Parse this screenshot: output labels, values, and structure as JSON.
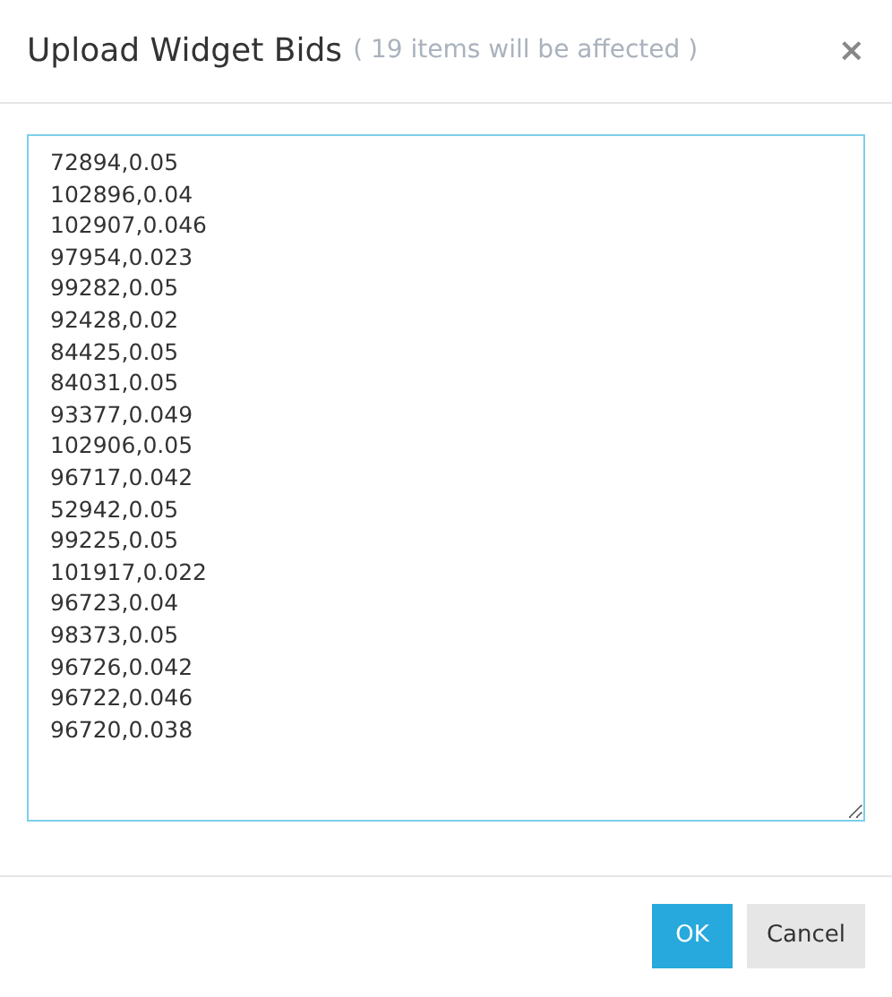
{
  "dialog": {
    "title": "Upload Widget Bids",
    "subtitle": "( 19 items will be affected )",
    "close": "×"
  },
  "input": {
    "value": [
      "72894,0.05",
      "102896,0.04",
      "102907,0.046",
      "97954,0.023",
      "99282,0.05",
      "92428,0.02",
      "84425,0.05",
      "84031,0.05",
      "93377,0.049",
      "102906,0.05",
      "96717,0.042",
      "52942,0.05",
      "99225,0.05",
      "101917,0.022",
      "96723,0.04",
      "98373,0.05",
      "96726,0.042",
      "96722,0.046",
      "96720,0.038"
    ]
  },
  "buttons": [
    {
      "label": "OK",
      "kind": "primary"
    },
    {
      "label": "Cancel",
      "kind": "secondary"
    }
  ]
}
